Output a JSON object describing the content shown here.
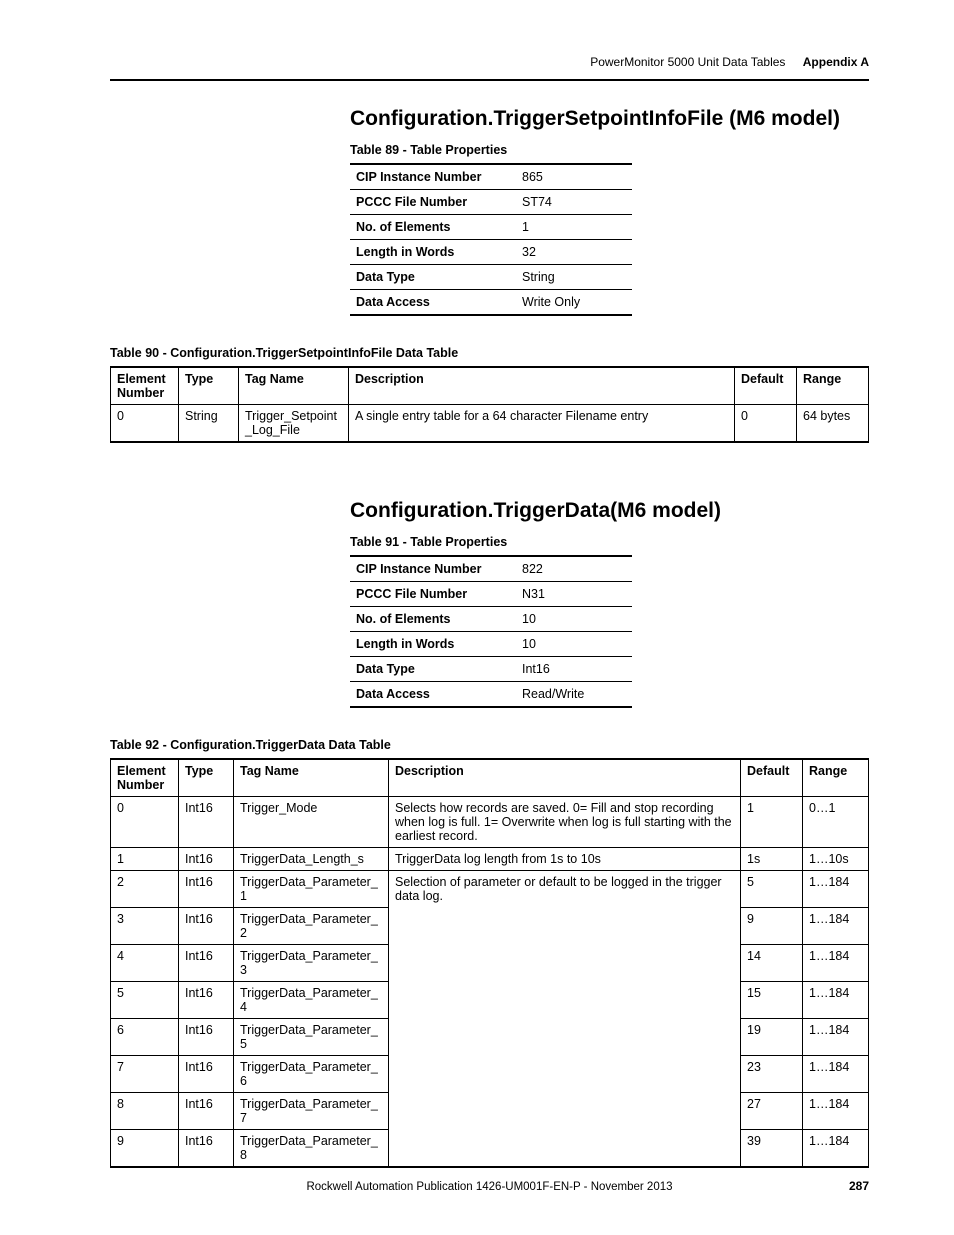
{
  "header": {
    "doc_title": "PowerMonitor 5000 Unit Data Tables",
    "appendix": "Appendix A"
  },
  "section1": {
    "title": "Configuration.TriggerSetpointInfoFile (M6 model)",
    "props_caption": "Table 89 - Table Properties",
    "props": [
      {
        "k": "CIP Instance Number",
        "v": "865"
      },
      {
        "k": "PCCC File Number",
        "v": "ST74"
      },
      {
        "k": "No. of Elements",
        "v": "1"
      },
      {
        "k": "Length in Words",
        "v": "32"
      },
      {
        "k": "Data Type",
        "v": "String"
      },
      {
        "k": "Data Access",
        "v": "Write Only"
      }
    ],
    "data_caption": "Table 90 - Configuration.TriggerSetpointInfoFile Data Table",
    "data_headers": {
      "c0": "Element Number",
      "c1": "Type",
      "c2": "Tag Name",
      "c3": "Description",
      "c4": "Default",
      "c5": "Range"
    },
    "data_rows": [
      {
        "c0": "0",
        "c1": "String",
        "c2": "Trigger_Setpoint_Log_File",
        "c3": "A single entry table for a 64 character Filename entry",
        "c4": "0",
        "c5": "64 bytes"
      }
    ]
  },
  "section2": {
    "title": "Configuration.TriggerData(M6 model)",
    "props_caption": "Table 91 - Table Properties",
    "props": [
      {
        "k": "CIP Instance Number",
        "v": "822"
      },
      {
        "k": "PCCC File Number",
        "v": "N31"
      },
      {
        "k": "No. of Elements",
        "v": "10"
      },
      {
        "k": "Length in Words",
        "v": "10"
      },
      {
        "k": "Data Type",
        "v": "Int16"
      },
      {
        "k": "Data Access",
        "v": "Read/Write"
      }
    ],
    "data_caption": "Table 92 - Configuration.TriggerData Data Table",
    "data_headers": {
      "c0": "Element Number",
      "c1": "Type",
      "c2": "Tag Name",
      "c3": "Description",
      "c4": "Default",
      "c5": "Range"
    },
    "data_rows": [
      {
        "c0": "0",
        "c1": "Int16",
        "c2": "Trigger_Mode",
        "c3": "Selects how records are saved.  0= Fill and stop recording when log is full. 1= Overwrite when log is full starting with the earliest record.",
        "c4": "1",
        "c5": "0…1"
      },
      {
        "c0": "1",
        "c1": "Int16",
        "c2": "TriggerData_Length_s",
        "c3": "TriggerData log length from 1s to 10s",
        "c4": "1s",
        "c5": "1…10s"
      },
      {
        "c0": "2",
        "c1": "Int16",
        "c2": "TriggerData_Parameter_1",
        "c3": "Selection of parameter or default to be logged in the trigger data log.",
        "c4": "5",
        "c5": "1…184"
      },
      {
        "c0": "3",
        "c1": "Int16",
        "c2": "TriggerData_Parameter_2",
        "c3": "",
        "c4": "9",
        "c5": "1…184"
      },
      {
        "c0": "4",
        "c1": "Int16",
        "c2": "TriggerData_Parameter_3",
        "c3": "",
        "c4": "14",
        "c5": "1…184"
      },
      {
        "c0": "5",
        "c1": "Int16",
        "c2": "TriggerData_Parameter_4",
        "c3": "",
        "c4": "15",
        "c5": "1…184"
      },
      {
        "c0": "6",
        "c1": "Int16",
        "c2": "TriggerData_Parameter_5",
        "c3": "",
        "c4": "19",
        "c5": "1…184"
      },
      {
        "c0": "7",
        "c1": "Int16",
        "c2": "TriggerData_Parameter_6",
        "c3": "",
        "c4": "23",
        "c5": "1…184"
      },
      {
        "c0": "8",
        "c1": "Int16",
        "c2": "TriggerData_Parameter_7",
        "c3": "",
        "c4": "27",
        "c5": "1…184"
      },
      {
        "c0": "9",
        "c1": "Int16",
        "c2": "TriggerData_Parameter_8",
        "c3": "",
        "c4": "39",
        "c5": "1…184"
      }
    ]
  },
  "footer": {
    "pub": "Rockwell Automation Publication 1426-UM001F-EN-P - November 2013",
    "page": "287"
  }
}
